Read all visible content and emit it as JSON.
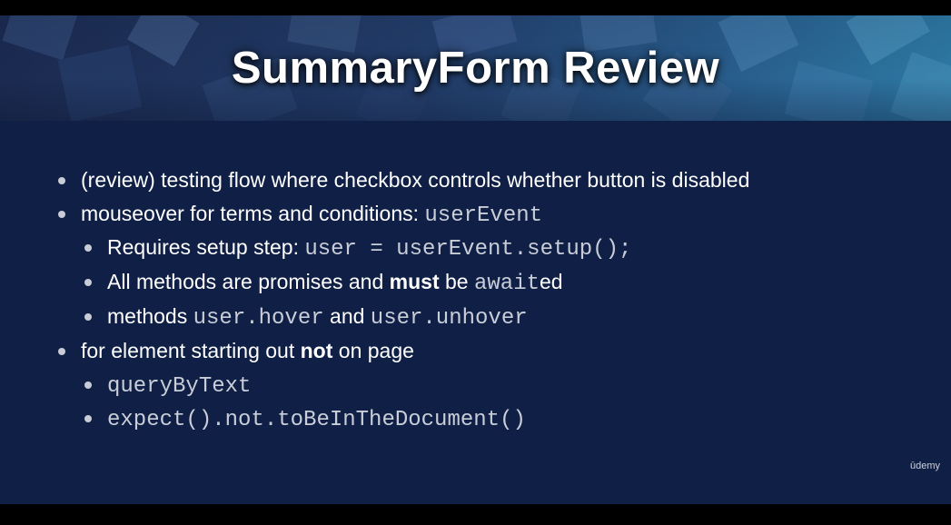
{
  "slide": {
    "title": "SummaryForm Review",
    "bullets": {
      "b1": {
        "text": "(review) testing flow where checkbox controls whether button is disabled"
      },
      "b2": {
        "text": "mouseover for terms and conditions: ",
        "code": "userEvent"
      },
      "b2a": {
        "text": "Requires setup step: ",
        "code": "user = userEvent.setup();"
      },
      "b2b": {
        "pre": "All methods are promises and ",
        "bold": "must",
        "mid": " be ",
        "code": "await",
        "post": "ed"
      },
      "b2c": {
        "pre": "methods ",
        "code1": "user.hover",
        "mid": " and ",
        "code2": "user.unhover"
      },
      "b3": {
        "pre": "for element starting out ",
        "bold": "not",
        "post": " on page"
      },
      "b3a": {
        "code": "queryByText"
      },
      "b3b": {
        "code": "expect().not.toBeInTheDocument()"
      }
    },
    "logo": "ūdemy"
  },
  "colors": {
    "background": "#0f1f45",
    "banner_accent": "#2f7fab",
    "text": "#ffffff",
    "code": "#c9cdd8"
  }
}
